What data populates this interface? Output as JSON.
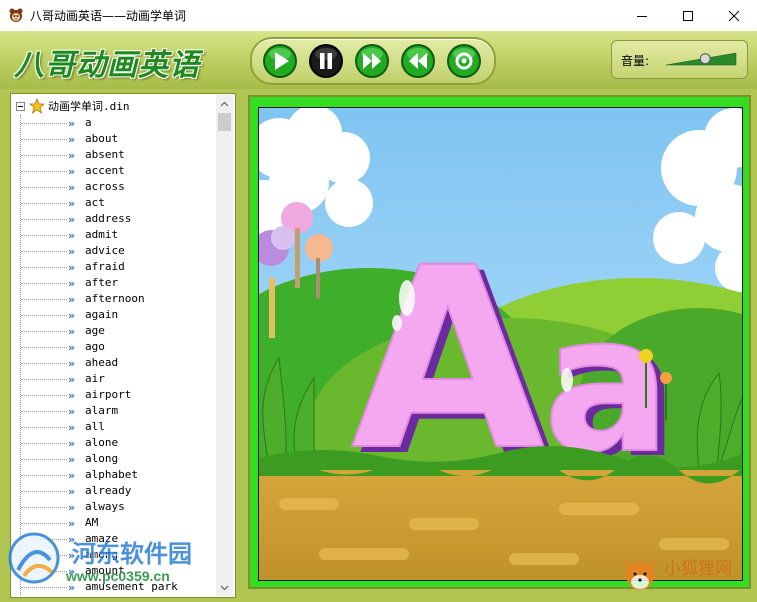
{
  "window": {
    "title": "八哥动画英语——动画学单词",
    "controls": {
      "minimize": "minimize-icon",
      "maximize": "maximize-icon",
      "close": "close-icon"
    }
  },
  "toolbar": {
    "logo_text": "八哥动画英语",
    "buttons": [
      {
        "name": "play-button",
        "icon": "play-icon"
      },
      {
        "name": "pause-button",
        "icon": "pause-icon"
      },
      {
        "name": "next-button",
        "icon": "next-icon"
      },
      {
        "name": "previous-button",
        "icon": "previous-icon"
      },
      {
        "name": "stop-button",
        "icon": "stop-icon"
      }
    ],
    "volume_label": "音量:",
    "volume_level": 0.55
  },
  "tree": {
    "root_label": "动画学单词.din",
    "root_icon": "star-icon",
    "items": [
      "a",
      "about",
      "absent",
      "accent",
      "across",
      "act",
      "address",
      "admit",
      "advice",
      "afraid",
      "after",
      "afternoon",
      "again",
      "age",
      "ago",
      "ahead",
      "air",
      "airport",
      "alarm",
      "all",
      "alone",
      "along",
      "alphabet",
      "already",
      "always",
      "AM",
      "amaze",
      "among",
      "amount",
      "amusement park"
    ]
  },
  "viewer": {
    "big_letter": "A",
    "small_letter": "a"
  },
  "watermarks": {
    "site_name": "河东软件园",
    "site_url": "www.pc0359.cn",
    "site2_name": "小狐狸网"
  },
  "colors": {
    "toolbar_green": "#b8cc5c",
    "frame_green": "#33dd22",
    "letter_pink": "#f4a8f0",
    "letter_shadow": "#6b2aa0",
    "accent_dark_green": "#1e8a1e"
  }
}
